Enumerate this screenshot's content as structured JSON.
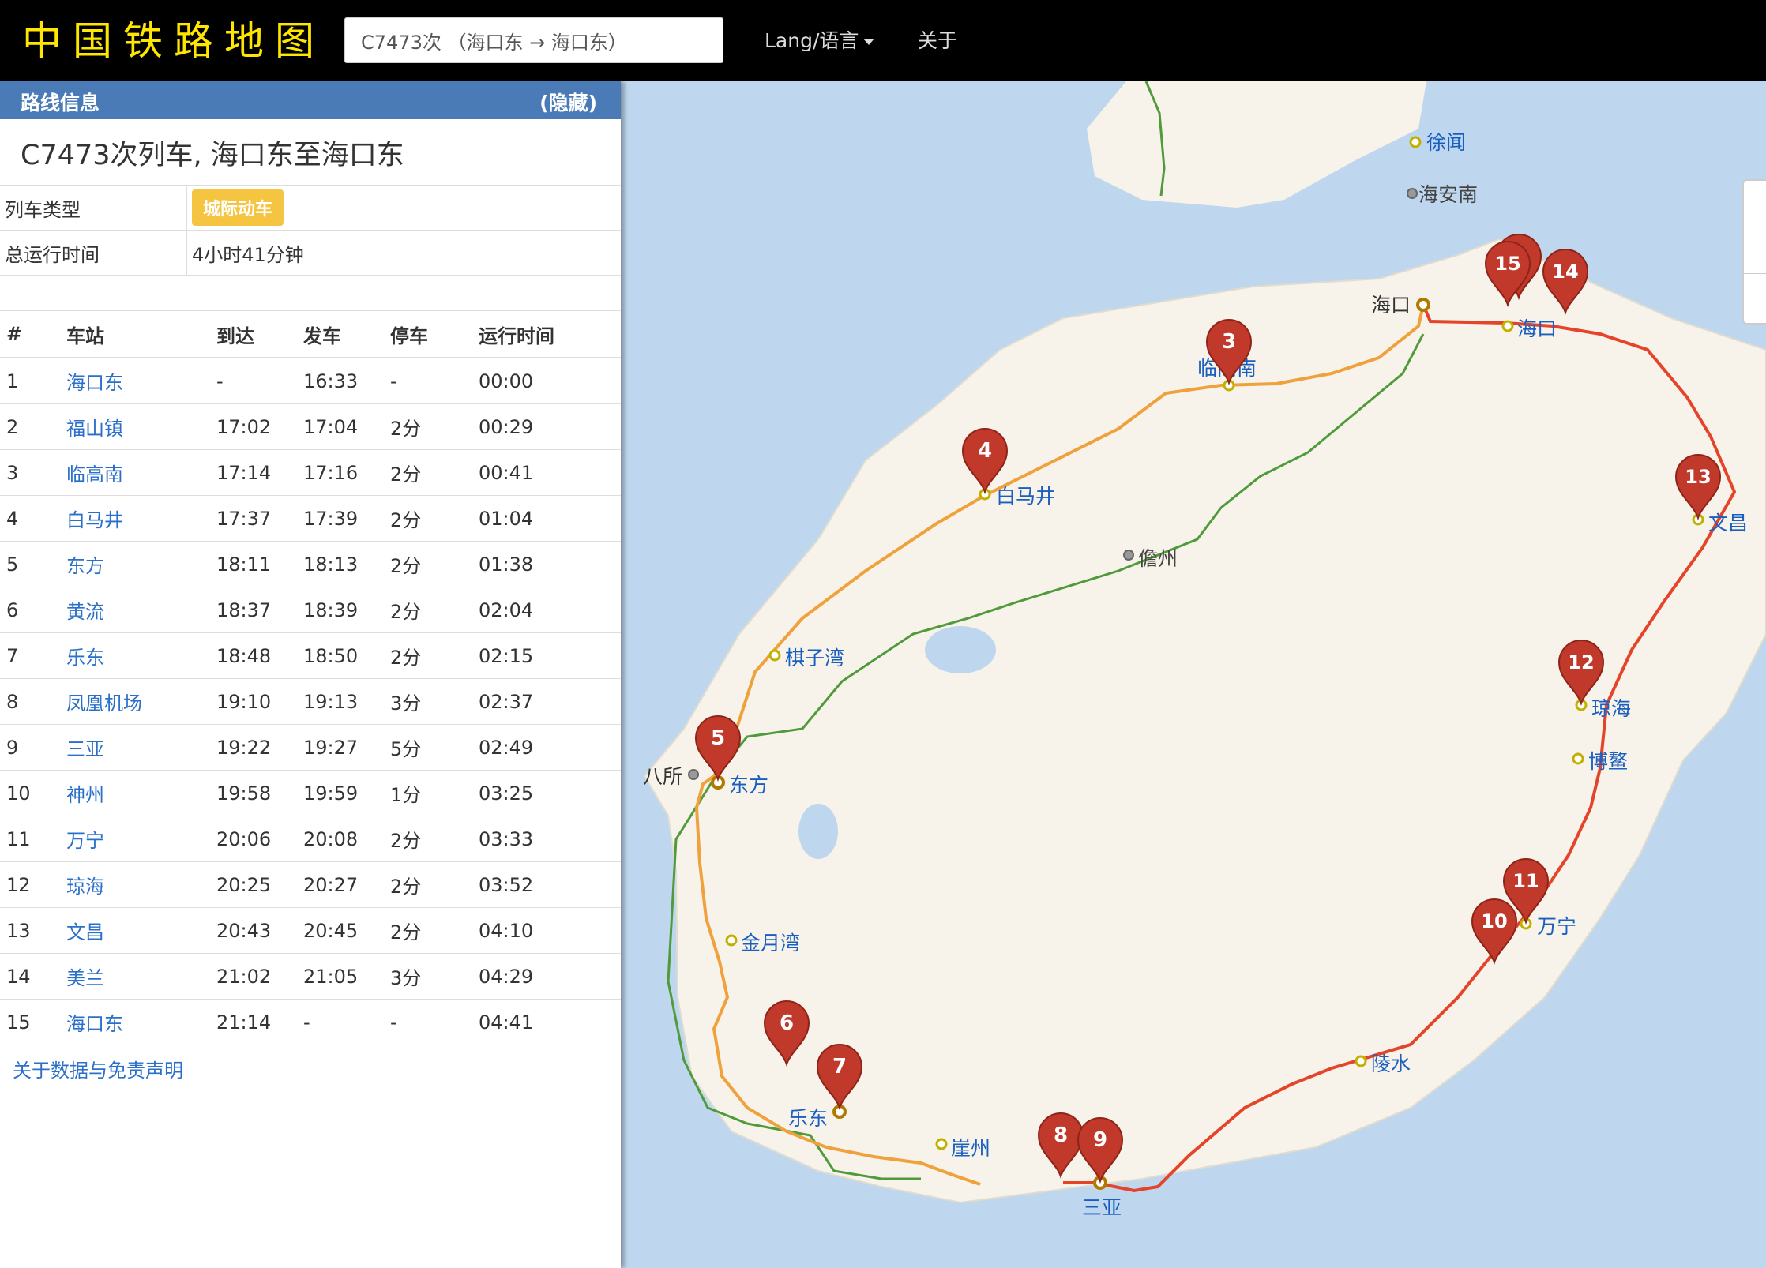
{
  "navbar": {
    "brand": "中国铁路地图",
    "search_value": "C7473次 （海口东 → 海口东）",
    "lang_label": "Lang/语言",
    "about_label": "关于"
  },
  "panel": {
    "header_title": "路线信息",
    "hide_label": "(隐藏)",
    "train_title": "C7473次列车, 海口东至海口东",
    "info": {
      "type_key": "列车类型",
      "type_value": "城际动车",
      "time_key": "总运行时间",
      "time_value": "4小时41分钟"
    },
    "columns": [
      "#",
      "车站",
      "到达",
      "发车",
      "停车",
      "运行时间"
    ],
    "rows": [
      [
        "1",
        "海口东",
        "-",
        "16:33",
        "-",
        "00:00"
      ],
      [
        "2",
        "福山镇",
        "17:02",
        "17:04",
        "2分",
        "00:29"
      ],
      [
        "3",
        "临高南",
        "17:14",
        "17:16",
        "2分",
        "00:41"
      ],
      [
        "4",
        "白马井",
        "17:37",
        "17:39",
        "2分",
        "01:04"
      ],
      [
        "5",
        "东方",
        "18:11",
        "18:13",
        "2分",
        "01:38"
      ],
      [
        "6",
        "黄流",
        "18:37",
        "18:39",
        "2分",
        "02:04"
      ],
      [
        "7",
        "乐东",
        "18:48",
        "18:50",
        "2分",
        "02:15"
      ],
      [
        "8",
        "凤凰机场",
        "19:10",
        "19:13",
        "3分",
        "02:37"
      ],
      [
        "9",
        "三亚",
        "19:22",
        "19:27",
        "5分",
        "02:49"
      ],
      [
        "10",
        "神州",
        "19:58",
        "19:59",
        "1分",
        "03:25"
      ],
      [
        "11",
        "万宁",
        "20:06",
        "20:08",
        "2分",
        "03:33"
      ],
      [
        "12",
        "琼海",
        "20:25",
        "20:27",
        "2分",
        "03:52"
      ],
      [
        "13",
        "文昌",
        "20:43",
        "20:45",
        "2分",
        "04:10"
      ],
      [
        "14",
        "美兰",
        "21:02",
        "21:05",
        "3分",
        "04:29"
      ],
      [
        "15",
        "海口东",
        "21:14",
        "-",
        "-",
        "04:41"
      ]
    ],
    "disclaimer": "关于数据与免责声明"
  },
  "map": {
    "colors": {
      "sea": "#bfd7ee",
      "land": "#f7f3ea",
      "route_red": "#e4452a",
      "route_orange": "#efa13c",
      "route_green": "#4f9a3a",
      "pin": "#c0392b",
      "label": "#1a5fc0"
    },
    "zoom_icons": [
      "zoom-in-icon",
      "zoom-out-icon",
      "layers-icon"
    ],
    "place_labels": {
      "xuwen": "徐闻",
      "haiannan": "海安南",
      "haikou": "海口",
      "haikou_e": "海口",
      "lingao": "临高南",
      "baimajing": "白马井",
      "danzhou": "儋州",
      "qiziwan": "棋子湾",
      "basuo": "八所",
      "dongfang": "东方",
      "jinyuewan": "金月湾",
      "ledong": "乐东",
      "yazhou": "崖州",
      "sanya": "三亚",
      "lingshui": "陵水",
      "wanning": "万宁",
      "boao": "博鳌",
      "qionghai": "琼海",
      "wenchang": "文昌"
    },
    "markers": [
      "2",
      "3",
      "4",
      "5",
      "6",
      "7",
      "8",
      "9",
      "10",
      "11",
      "12",
      "13",
      "14",
      "15"
    ]
  }
}
